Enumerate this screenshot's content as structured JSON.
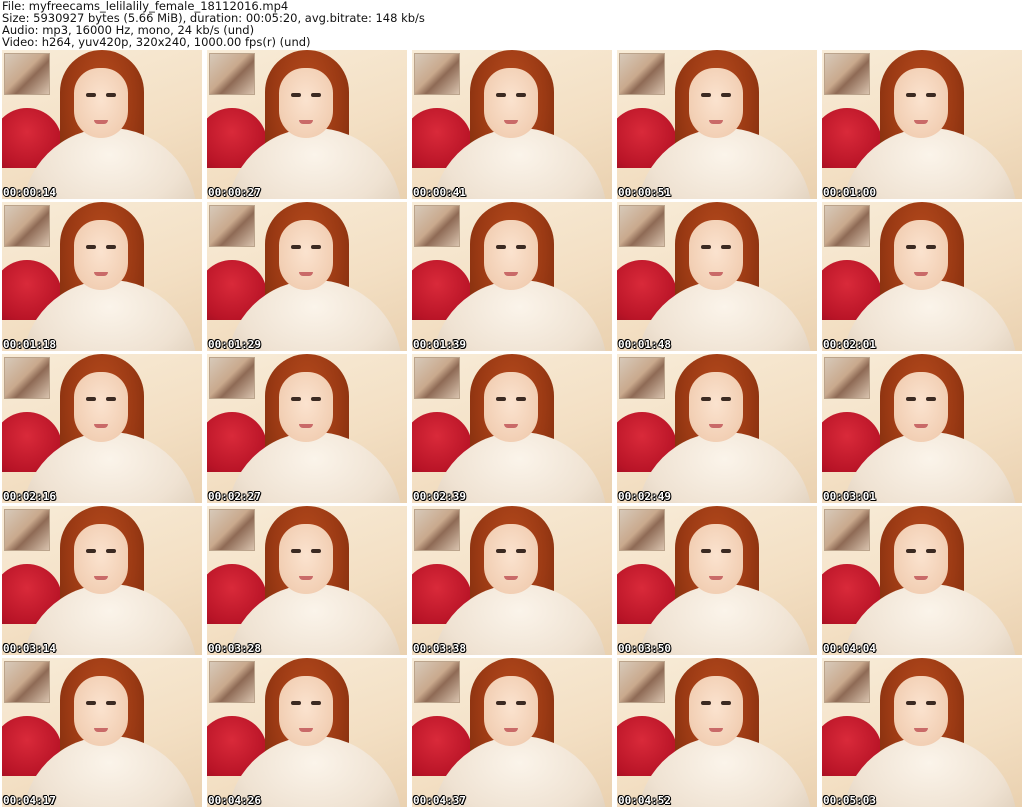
{
  "header": {
    "file_line": "File: myfreecams_lelilalily_female_18112016.mp4",
    "size_line": "Size: 5930927 bytes (5.66 MiB), duration: 00:05:20, avg.bitrate: 148 kb/s",
    "audio_line": "Audio: mp3, 16000 Hz, mono, 24 kb/s (und)",
    "video_line": "Video: h264, yuv420p, 320x240, 1000.00 fps(r) (und)"
  },
  "thumbnails": [
    {
      "timestamp": "00:00:14"
    },
    {
      "timestamp": "00:00:27"
    },
    {
      "timestamp": "00:00:41"
    },
    {
      "timestamp": "00:00:51"
    },
    {
      "timestamp": "00:01:00"
    },
    {
      "timestamp": "00:01:18"
    },
    {
      "timestamp": "00:01:29"
    },
    {
      "timestamp": "00:01:39"
    },
    {
      "timestamp": "00:01:48"
    },
    {
      "timestamp": "00:02:01"
    },
    {
      "timestamp": "00:02:16"
    },
    {
      "timestamp": "00:02:27"
    },
    {
      "timestamp": "00:02:39"
    },
    {
      "timestamp": "00:02:49"
    },
    {
      "timestamp": "00:03:01"
    },
    {
      "timestamp": "00:03:14"
    },
    {
      "timestamp": "00:03:28"
    },
    {
      "timestamp": "00:03:38"
    },
    {
      "timestamp": "00:03:50"
    },
    {
      "timestamp": "00:04:04"
    },
    {
      "timestamp": "00:04:17"
    },
    {
      "timestamp": "00:04:26"
    },
    {
      "timestamp": "00:04:37"
    },
    {
      "timestamp": "00:04:52"
    },
    {
      "timestamp": "00:05:03"
    }
  ]
}
